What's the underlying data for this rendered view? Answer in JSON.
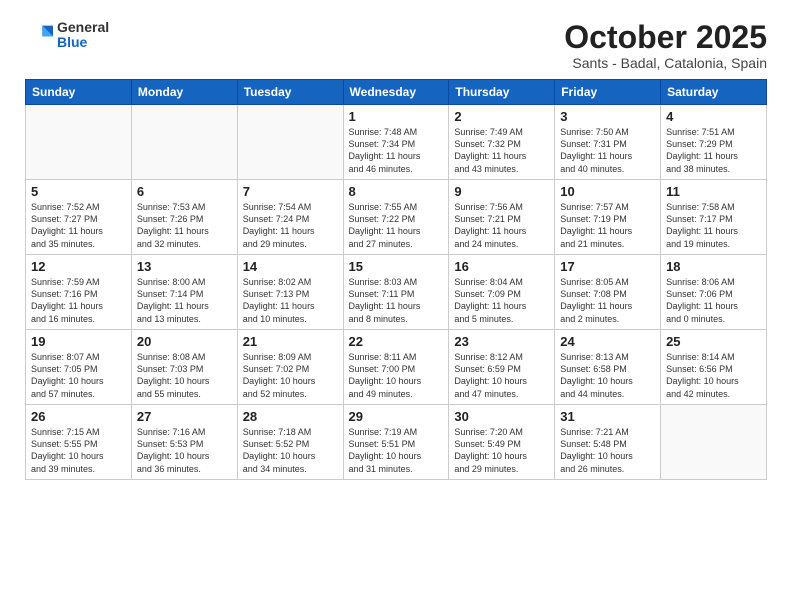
{
  "logo": {
    "general": "General",
    "blue": "Blue"
  },
  "header": {
    "title": "October 2025",
    "subtitle": "Sants - Badal, Catalonia, Spain"
  },
  "weekdays": [
    "Sunday",
    "Monday",
    "Tuesday",
    "Wednesday",
    "Thursday",
    "Friday",
    "Saturday"
  ],
  "weeks": [
    [
      {
        "day": "",
        "info": ""
      },
      {
        "day": "",
        "info": ""
      },
      {
        "day": "",
        "info": ""
      },
      {
        "day": "1",
        "info": "Sunrise: 7:48 AM\nSunset: 7:34 PM\nDaylight: 11 hours\nand 46 minutes."
      },
      {
        "day": "2",
        "info": "Sunrise: 7:49 AM\nSunset: 7:32 PM\nDaylight: 11 hours\nand 43 minutes."
      },
      {
        "day": "3",
        "info": "Sunrise: 7:50 AM\nSunset: 7:31 PM\nDaylight: 11 hours\nand 40 minutes."
      },
      {
        "day": "4",
        "info": "Sunrise: 7:51 AM\nSunset: 7:29 PM\nDaylight: 11 hours\nand 38 minutes."
      }
    ],
    [
      {
        "day": "5",
        "info": "Sunrise: 7:52 AM\nSunset: 7:27 PM\nDaylight: 11 hours\nand 35 minutes."
      },
      {
        "day": "6",
        "info": "Sunrise: 7:53 AM\nSunset: 7:26 PM\nDaylight: 11 hours\nand 32 minutes."
      },
      {
        "day": "7",
        "info": "Sunrise: 7:54 AM\nSunset: 7:24 PM\nDaylight: 11 hours\nand 29 minutes."
      },
      {
        "day": "8",
        "info": "Sunrise: 7:55 AM\nSunset: 7:22 PM\nDaylight: 11 hours\nand 27 minutes."
      },
      {
        "day": "9",
        "info": "Sunrise: 7:56 AM\nSunset: 7:21 PM\nDaylight: 11 hours\nand 24 minutes."
      },
      {
        "day": "10",
        "info": "Sunrise: 7:57 AM\nSunset: 7:19 PM\nDaylight: 11 hours\nand 21 minutes."
      },
      {
        "day": "11",
        "info": "Sunrise: 7:58 AM\nSunset: 7:17 PM\nDaylight: 11 hours\nand 19 minutes."
      }
    ],
    [
      {
        "day": "12",
        "info": "Sunrise: 7:59 AM\nSunset: 7:16 PM\nDaylight: 11 hours\nand 16 minutes."
      },
      {
        "day": "13",
        "info": "Sunrise: 8:00 AM\nSunset: 7:14 PM\nDaylight: 11 hours\nand 13 minutes."
      },
      {
        "day": "14",
        "info": "Sunrise: 8:02 AM\nSunset: 7:13 PM\nDaylight: 11 hours\nand 10 minutes."
      },
      {
        "day": "15",
        "info": "Sunrise: 8:03 AM\nSunset: 7:11 PM\nDaylight: 11 hours\nand 8 minutes."
      },
      {
        "day": "16",
        "info": "Sunrise: 8:04 AM\nSunset: 7:09 PM\nDaylight: 11 hours\nand 5 minutes."
      },
      {
        "day": "17",
        "info": "Sunrise: 8:05 AM\nSunset: 7:08 PM\nDaylight: 11 hours\nand 2 minutes."
      },
      {
        "day": "18",
        "info": "Sunrise: 8:06 AM\nSunset: 7:06 PM\nDaylight: 11 hours\nand 0 minutes."
      }
    ],
    [
      {
        "day": "19",
        "info": "Sunrise: 8:07 AM\nSunset: 7:05 PM\nDaylight: 10 hours\nand 57 minutes."
      },
      {
        "day": "20",
        "info": "Sunrise: 8:08 AM\nSunset: 7:03 PM\nDaylight: 10 hours\nand 55 minutes."
      },
      {
        "day": "21",
        "info": "Sunrise: 8:09 AM\nSunset: 7:02 PM\nDaylight: 10 hours\nand 52 minutes."
      },
      {
        "day": "22",
        "info": "Sunrise: 8:11 AM\nSunset: 7:00 PM\nDaylight: 10 hours\nand 49 minutes."
      },
      {
        "day": "23",
        "info": "Sunrise: 8:12 AM\nSunset: 6:59 PM\nDaylight: 10 hours\nand 47 minutes."
      },
      {
        "day": "24",
        "info": "Sunrise: 8:13 AM\nSunset: 6:58 PM\nDaylight: 10 hours\nand 44 minutes."
      },
      {
        "day": "25",
        "info": "Sunrise: 8:14 AM\nSunset: 6:56 PM\nDaylight: 10 hours\nand 42 minutes."
      }
    ],
    [
      {
        "day": "26",
        "info": "Sunrise: 7:15 AM\nSunset: 5:55 PM\nDaylight: 10 hours\nand 39 minutes."
      },
      {
        "day": "27",
        "info": "Sunrise: 7:16 AM\nSunset: 5:53 PM\nDaylight: 10 hours\nand 36 minutes."
      },
      {
        "day": "28",
        "info": "Sunrise: 7:18 AM\nSunset: 5:52 PM\nDaylight: 10 hours\nand 34 minutes."
      },
      {
        "day": "29",
        "info": "Sunrise: 7:19 AM\nSunset: 5:51 PM\nDaylight: 10 hours\nand 31 minutes."
      },
      {
        "day": "30",
        "info": "Sunrise: 7:20 AM\nSunset: 5:49 PM\nDaylight: 10 hours\nand 29 minutes."
      },
      {
        "day": "31",
        "info": "Sunrise: 7:21 AM\nSunset: 5:48 PM\nDaylight: 10 hours\nand 26 minutes."
      },
      {
        "day": "",
        "info": ""
      }
    ]
  ]
}
